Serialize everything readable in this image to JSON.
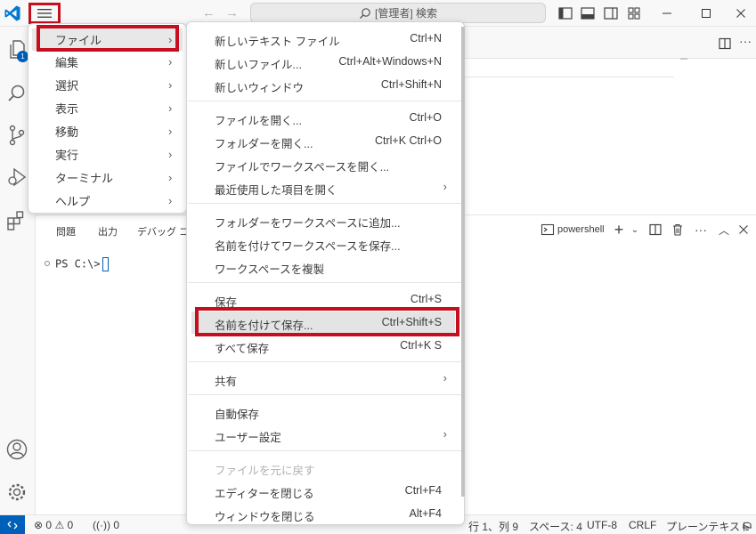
{
  "titlebar": {
    "search_text": "[管理者] 検索"
  },
  "editor": {},
  "panel": {
    "tabs": [
      "問題",
      "出力",
      "デバッグ コン"
    ],
    "terminal_prompt": "PS C:\\>",
    "terminal_name": "powershell"
  },
  "statusbar": {
    "errors": "0",
    "warnings": "0",
    "ports": "0",
    "position": "行 1、列 9",
    "spaces": "スペース: 4",
    "encoding": "UTF-8",
    "eol": "CRLF",
    "language": "プレーンテキスト"
  },
  "main_menu": {
    "items": [
      {
        "label": "ファイル"
      },
      {
        "label": "編集"
      },
      {
        "label": "選択"
      },
      {
        "label": "表示"
      },
      {
        "label": "移動"
      },
      {
        "label": "実行"
      },
      {
        "label": "ターミナル"
      },
      {
        "label": "ヘルプ"
      }
    ]
  },
  "file_menu": {
    "items": [
      {
        "label": "新しいテキスト ファイル",
        "shortcut": "Ctrl+N"
      },
      {
        "label": "新しいファイル...",
        "shortcut": "Ctrl+Alt+Windows+N"
      },
      {
        "label": "新しいウィンドウ",
        "shortcut": "Ctrl+Shift+N"
      },
      {
        "label": "ファイルを開く...",
        "shortcut": "Ctrl+O"
      },
      {
        "label": "フォルダーを開く...",
        "shortcut": "Ctrl+K Ctrl+O"
      },
      {
        "label": "ファイルでワークスペースを開く...",
        "shortcut": ""
      },
      {
        "label": "最近使用した項目を開く",
        "shortcut": ""
      },
      {
        "label": "フォルダーをワークスペースに追加...",
        "shortcut": ""
      },
      {
        "label": "名前を付けてワークスペースを保存...",
        "shortcut": ""
      },
      {
        "label": "ワークスペースを複製",
        "shortcut": ""
      },
      {
        "label": "保存",
        "shortcut": "Ctrl+S"
      },
      {
        "label": "名前を付けて保存...",
        "shortcut": "Ctrl+Shift+S"
      },
      {
        "label": "すべて保存",
        "shortcut": "Ctrl+K S"
      },
      {
        "label": "共有",
        "shortcut": ""
      },
      {
        "label": "自動保存",
        "shortcut": ""
      },
      {
        "label": "ユーザー設定",
        "shortcut": ""
      },
      {
        "label": "ファイルを元に戻す",
        "shortcut": ""
      },
      {
        "label": "エディターを閉じる",
        "shortcut": "Ctrl+F4"
      },
      {
        "label": "ウィンドウを閉じる",
        "shortcut": "Alt+F4"
      }
    ]
  },
  "colors": {
    "accent": "#005fb8",
    "highlight_border": "#c50f1f"
  }
}
